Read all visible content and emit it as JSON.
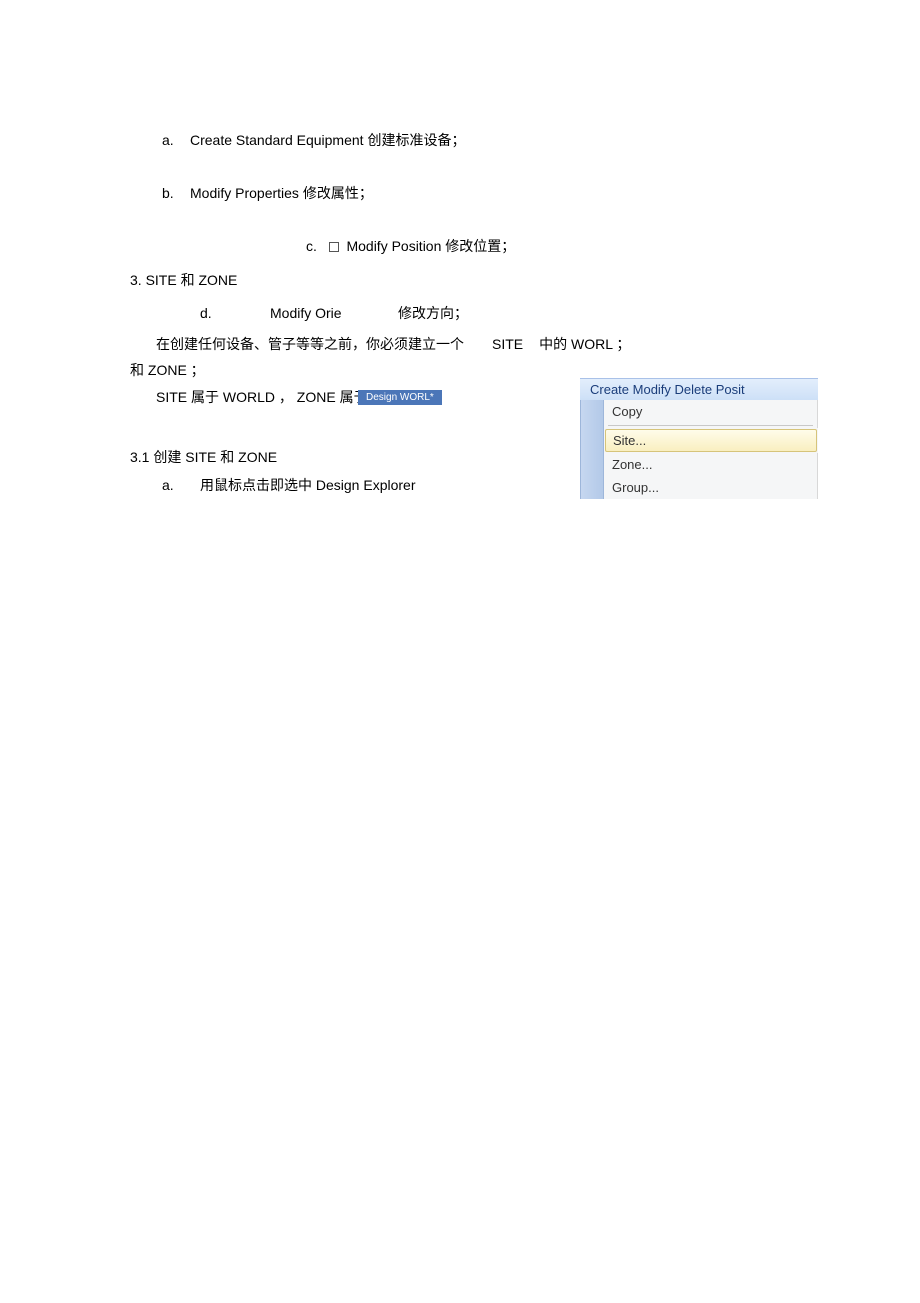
{
  "items": {
    "a": {
      "letter": "a.",
      "text": "Create Standard Equipment 创建标准设备；"
    },
    "b": {
      "letter": "b.",
      "text": "Modify Properties 修改属性；"
    },
    "c": {
      "letter": "c.",
      "text": "Modify Position 修改位置；"
    },
    "d": {
      "letter": "d.",
      "text1": "Modify Orie",
      "text2": "修改方向；"
    }
  },
  "section3": {
    "heading": "3.  SITE 和  ZONE",
    "para1_left": "在创建任何设备、管子等等之前，你必须建立一个",
    "para1_site": "SITE",
    "para1_right": "中的 WORL ；",
    "para2": "和 ZONE ；",
    "para3": "SITE 属于  WORLD ， ZONE 属于  SITE；"
  },
  "design_pill": "Design WORL*",
  "section31": {
    "heading": "3.1 创建  SITE 和  ZONE",
    "a": {
      "letter": "a.",
      "text": "用鼠标点击即选中  Design Explorer"
    }
  },
  "menu": {
    "top": "Create Modify Delete Posit",
    "copy": "Copy",
    "site": "Site...",
    "zone": "Zone...",
    "group": "Group..."
  }
}
